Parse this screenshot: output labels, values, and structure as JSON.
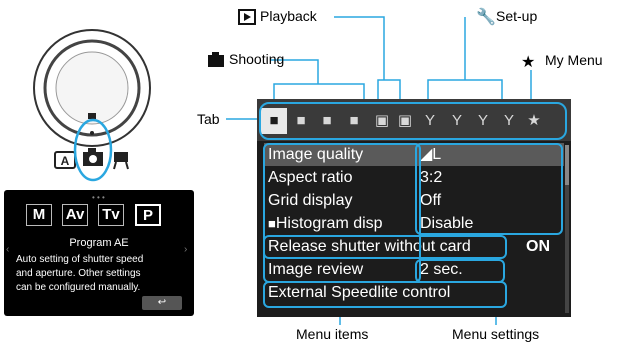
{
  "labels": {
    "shooting": "Shooting",
    "playback": "Playback",
    "setup": "Set-up",
    "mymenu": "My Menu",
    "tab": "Tab",
    "menu_items": "Menu items",
    "menu_settings": "Menu settings"
  },
  "icons": {
    "shooting": "camera-icon",
    "playback": "play-icon",
    "setup": "wrench-icon",
    "mymenu": "star-icon"
  },
  "tabs": [
    "camera-1",
    "camera-2",
    "camera-3",
    "camera-4",
    "play-1",
    "play-2",
    "wrench-1",
    "wrench-2",
    "wrench-3",
    "wrench-4",
    "star"
  ],
  "menu": [
    {
      "name": "Image quality",
      "value": "◢L"
    },
    {
      "name": "Aspect ratio",
      "value": "3:2"
    },
    {
      "name": "Grid display",
      "value": "Off"
    },
    {
      "name": "Histogram disp",
      "value": "Disable"
    },
    {
      "name": "Release shutter without card",
      "value": "ON"
    },
    {
      "name": "Image review",
      "value": "2 sec."
    },
    {
      "name": "External Speedlite control",
      "value": ""
    }
  ],
  "mode_card": {
    "buttons": [
      "M",
      "Av",
      "Tv",
      "P"
    ],
    "selected": "P",
    "title": "Program AE",
    "lines": [
      "Auto setting of shutter speed",
      "and aperture. Other settings",
      "can be configured manually."
    ],
    "back": "↩"
  },
  "colors": {
    "highlight": "#2aa7e0",
    "screen": "#1c1c1c"
  }
}
